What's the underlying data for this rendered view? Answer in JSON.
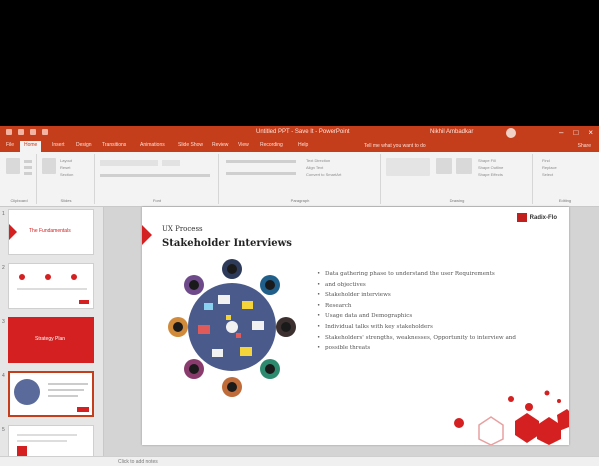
{
  "window": {
    "title": "Untitled PPT - Save It - PowerPoint",
    "user": "Nikhil Ambadkar"
  },
  "tabs": [
    "File",
    "Home",
    "Insert",
    "Design",
    "Transitions",
    "Animations",
    "Slide Show",
    "Review",
    "View",
    "Recording",
    "Help"
  ],
  "tell_me": "Tell me what you want to do",
  "share_label": "Share",
  "ribbon": {
    "groups": [
      "Clipboard",
      "Slides",
      "Font",
      "Paragraph",
      "Drawing",
      "Editing"
    ],
    "slides_buttons": [
      "Layout",
      "Reset",
      "Section"
    ],
    "paragraph_buttons": [
      "Text Direction",
      "Align Text",
      "Convert to SmartArt"
    ],
    "drawing_buttons": [
      "Shape Fill",
      "Shape Outline",
      "Shape Effects"
    ],
    "editing_buttons": [
      "Find",
      "Replace",
      "Select"
    ]
  },
  "thumbnails": [
    {
      "number": "1",
      "label": "The Fundamentals"
    },
    {
      "number": "2",
      "label": ""
    },
    {
      "number": "3",
      "label": "Strategy Plan"
    },
    {
      "number": "4",
      "label": ""
    },
    {
      "number": "5",
      "label": ""
    }
  ],
  "slide": {
    "title": "UX Process",
    "heading": "Stakeholder Interviews",
    "logo_text": "Radix-Flo",
    "bullets": [
      "Data gathering phase to understand the user Requirements",
      "and objectives",
      "Stakeholder interviews",
      "Research",
      "Usage data and Demographics",
      "Individual talks with key stakeholders",
      "Stakeholders' strengths, weaknesses, Opportunity to interview and",
      "possible threats"
    ]
  },
  "status": {
    "notes": "Click to add notes"
  },
  "colors": {
    "accent": "#c43e1c",
    "slide_red": "#d42020"
  }
}
